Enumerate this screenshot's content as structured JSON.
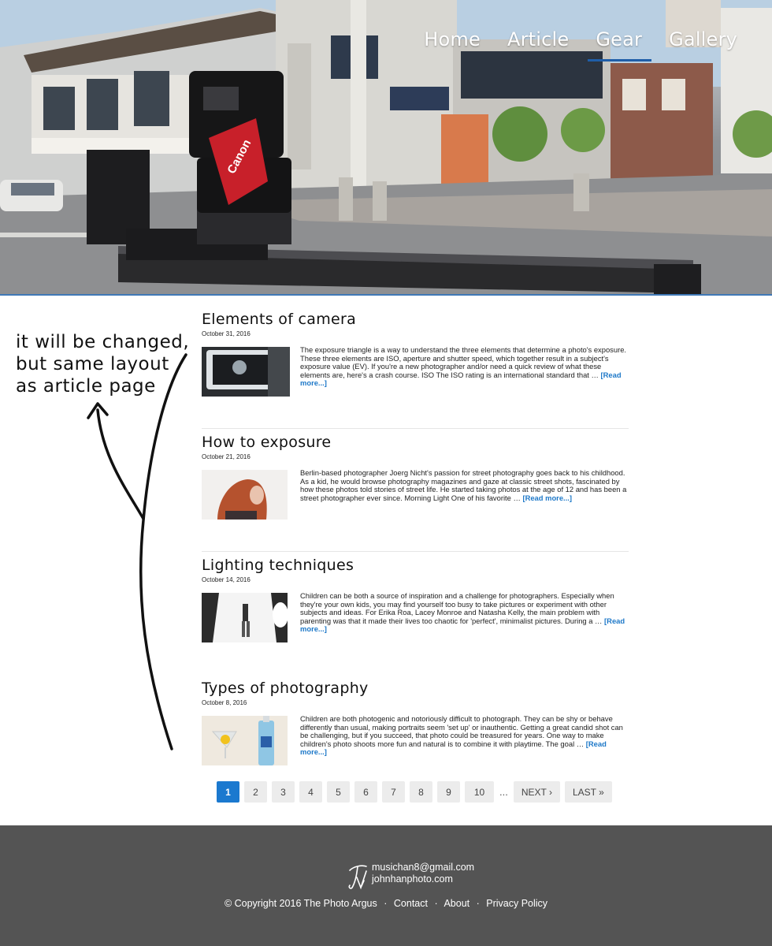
{
  "nav": {
    "items": [
      {
        "label": "Home",
        "active": false
      },
      {
        "label": "Article",
        "active": false
      },
      {
        "label": "Gear",
        "active": true
      },
      {
        "label": "Gallery",
        "active": false
      }
    ],
    "active_color": "#1f5ea8"
  },
  "hero": {
    "icon": "camera-slider-street-photo",
    "camera_brand": "Canon"
  },
  "annotation": {
    "lines": [
      "it will be changed,",
      "but same layout",
      "as article page"
    ]
  },
  "articles": [
    {
      "title": "Elements of camera",
      "date": "October 31, 2016",
      "excerpt": "The exposure triangle is a way to understand the three elements that determine a photo's exposure. These three elements are ISO, aperture and shutter speed, which together result in a subject's exposure value (EV). If you're a new photographer and/or need a quick review of what these elements are, here's a crash course. ISO The ISO rating is an international standard that …",
      "read_more": "[Read more...]",
      "thumb": "camera-screen-thumbnail"
    },
    {
      "title": "How to exposure",
      "date": "October 21, 2016",
      "excerpt": "Berlin-based photographer Joerg Nicht's passion for street photography goes back to his childhood. As a kid, he would browse photography magazines and gaze at classic street shots, fascinated by how these photos told stories of street life. He started taking photos at the age of 12 and has been a street photographer ever since. Morning Light One of his favorite …",
      "read_more": "[Read more...]",
      "thumb": "red-hair-portrait-thumbnail"
    },
    {
      "title": "Lighting techniques",
      "date": "October 14, 2016",
      "excerpt": "Children can be both a source of inspiration and a challenge for photographers. Especially when they're your own kids, you may find yourself too busy to take pictures or experiment with other subjects and ideas. For Erika Roa, Lacey Monroe and Natasha Kelly, the main problem with parenting was that it made their lives too chaotic for 'perfect', minimalist pictures. During a …",
      "read_more": "[Read more...]",
      "thumb": "studio-lighting-thumbnail"
    },
    {
      "title": "Types of photography",
      "date": "October 8, 2016",
      "excerpt": "Children are both photogenic and notoriously difficult to photograph. They can be shy or behave differently than usual, making portraits seem 'set up' or inauthentic. Getting a great candid shot can be challenging, but if you succeed, that photo could be treasured for years. One way to make children's photo shoots more fun and natural is to combine it with playtime. The goal …",
      "read_more": "[Read more...]",
      "thumb": "glass-bottle-thumbnail"
    }
  ],
  "pagination": {
    "pages": [
      "1",
      "2",
      "3",
      "4",
      "5",
      "6",
      "7",
      "8",
      "9",
      "10"
    ],
    "current": "1",
    "ellipsis": "...",
    "next": "NEXT ›",
    "last": "LAST »"
  },
  "footer": {
    "email": "musichan8@gmail.com",
    "website": "johnhanphoto.com",
    "copyright": "© Copyright 2016 The Photo Argus",
    "links": [
      "Contact",
      "About",
      "Privacy Policy"
    ],
    "separator": "·",
    "logo_icon": "signature-logo-icon"
  },
  "colors": {
    "accent": "#1b79cf",
    "footer_bg": "#545454",
    "link": "#1d78c8"
  }
}
